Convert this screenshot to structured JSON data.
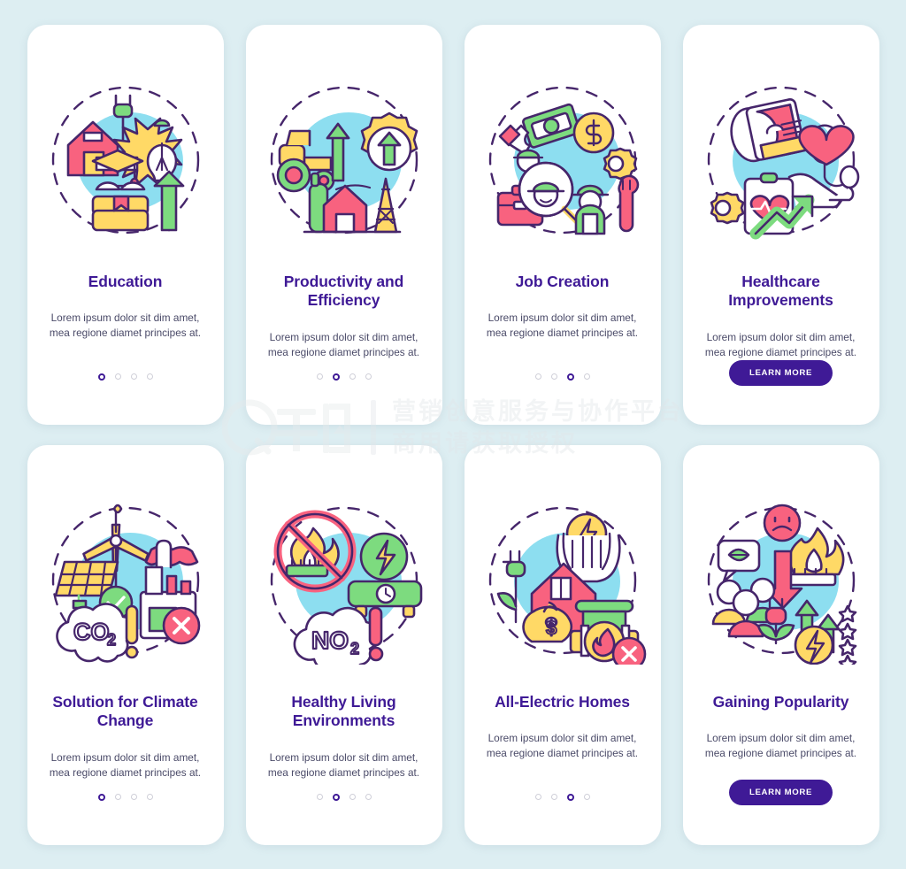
{
  "meta": {
    "background_color": "#ddeef2",
    "card_background": "#ffffff",
    "title_color": "#3f1a96",
    "body_color": "#4a4a68",
    "accent_purple": "#3f1a96",
    "illustration_blob": "#8ddef0",
    "palette": {
      "yellow": "#ffd966",
      "light_yellow": "#ffe699",
      "pink": "#f8627f",
      "light_pink": "#f98ca3",
      "green": "#7ddb7f",
      "light_green": "#a8e6a0",
      "outline": "#46266b",
      "white": "#ffffff"
    }
  },
  "watermark": {
    "line1": "营销创意服务与协作平台",
    "line2": "商用请获取授权",
    "logo_text": "千图"
  },
  "cards": [
    {
      "id": "education",
      "title": "Education",
      "description": "Lorem ipsum dolor sit dim amet, mea regione diamet principes at.",
      "footer_type": "dots",
      "dots_total": 4,
      "dots_active": 1,
      "illustration": "education-icon"
    },
    {
      "id": "productivity-and-efficiency",
      "title": "Productivity and Efficiency",
      "description": "Lorem ipsum dolor sit dim amet, mea regione diamet principes at.",
      "footer_type": "dots",
      "dots_total": 4,
      "dots_active": 2,
      "illustration": "productivity-icon"
    },
    {
      "id": "job-creation",
      "title": "Job Creation",
      "description": "Lorem ipsum dolor sit dim amet, mea regione diamet principes at.",
      "footer_type": "dots",
      "dots_total": 4,
      "dots_active": 3,
      "illustration": "job-creation-icon"
    },
    {
      "id": "healthcare-improvements",
      "title": "Healthcare Improvements",
      "description": "Lorem ipsum dolor sit dim amet, mea regione diamet principes at.",
      "footer_type": "button",
      "button_label": "LEARN MORE",
      "illustration": "healthcare-icon"
    },
    {
      "id": "solution-for-climate-change",
      "title": "Solution for Climate Change",
      "description": "Lorem ipsum dolor sit dim amet, mea regione diamet principes at.",
      "footer_type": "dots",
      "dots_total": 4,
      "dots_active": 1,
      "illustration": "climate-change-icon"
    },
    {
      "id": "healthy-living-environments",
      "title": "Healthy Living Environments",
      "description": "Lorem ipsum dolor sit dim amet, mea regione diamet principes at.",
      "footer_type": "dots",
      "dots_total": 4,
      "dots_active": 2,
      "illustration": "healthy-living-icon"
    },
    {
      "id": "all-electric-homes",
      "title": "All-Electric Homes",
      "description": "Lorem ipsum dolor sit dim amet, mea regione diamet principes at.",
      "footer_type": "dots",
      "dots_total": 4,
      "dots_active": 3,
      "illustration": "all-electric-homes-icon"
    },
    {
      "id": "gaining-popularity",
      "title": "Gaining Popularity",
      "description": "Lorem ipsum dolor sit dim amet, mea regione diamet principes at.",
      "footer_type": "button",
      "button_label": "LEARN MORE",
      "illustration": "gaining-popularity-icon"
    }
  ]
}
